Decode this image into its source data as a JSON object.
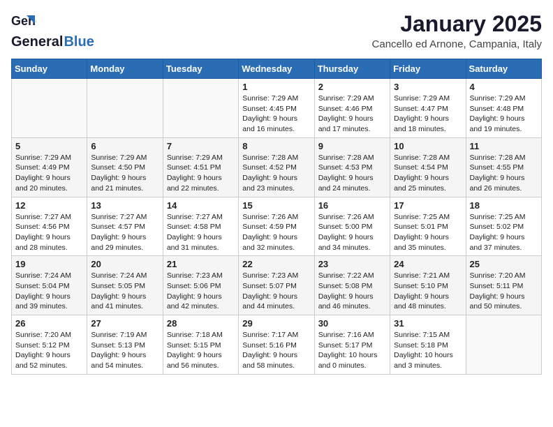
{
  "header": {
    "logo_general": "General",
    "logo_blue": "Blue",
    "month_title": "January 2025",
    "location": "Cancello ed Arnone, Campania, Italy"
  },
  "weekdays": [
    "Sunday",
    "Monday",
    "Tuesday",
    "Wednesday",
    "Thursday",
    "Friday",
    "Saturday"
  ],
  "weeks": [
    [
      {
        "day": "",
        "info": ""
      },
      {
        "day": "",
        "info": ""
      },
      {
        "day": "",
        "info": ""
      },
      {
        "day": "1",
        "info": "Sunrise: 7:29 AM\nSunset: 4:45 PM\nDaylight: 9 hours\nand 16 minutes."
      },
      {
        "day": "2",
        "info": "Sunrise: 7:29 AM\nSunset: 4:46 PM\nDaylight: 9 hours\nand 17 minutes."
      },
      {
        "day": "3",
        "info": "Sunrise: 7:29 AM\nSunset: 4:47 PM\nDaylight: 9 hours\nand 18 minutes."
      },
      {
        "day": "4",
        "info": "Sunrise: 7:29 AM\nSunset: 4:48 PM\nDaylight: 9 hours\nand 19 minutes."
      }
    ],
    [
      {
        "day": "5",
        "info": "Sunrise: 7:29 AM\nSunset: 4:49 PM\nDaylight: 9 hours\nand 20 minutes."
      },
      {
        "day": "6",
        "info": "Sunrise: 7:29 AM\nSunset: 4:50 PM\nDaylight: 9 hours\nand 21 minutes."
      },
      {
        "day": "7",
        "info": "Sunrise: 7:29 AM\nSunset: 4:51 PM\nDaylight: 9 hours\nand 22 minutes."
      },
      {
        "day": "8",
        "info": "Sunrise: 7:28 AM\nSunset: 4:52 PM\nDaylight: 9 hours\nand 23 minutes."
      },
      {
        "day": "9",
        "info": "Sunrise: 7:28 AM\nSunset: 4:53 PM\nDaylight: 9 hours\nand 24 minutes."
      },
      {
        "day": "10",
        "info": "Sunrise: 7:28 AM\nSunset: 4:54 PM\nDaylight: 9 hours\nand 25 minutes."
      },
      {
        "day": "11",
        "info": "Sunrise: 7:28 AM\nSunset: 4:55 PM\nDaylight: 9 hours\nand 26 minutes."
      }
    ],
    [
      {
        "day": "12",
        "info": "Sunrise: 7:27 AM\nSunset: 4:56 PM\nDaylight: 9 hours\nand 28 minutes."
      },
      {
        "day": "13",
        "info": "Sunrise: 7:27 AM\nSunset: 4:57 PM\nDaylight: 9 hours\nand 29 minutes."
      },
      {
        "day": "14",
        "info": "Sunrise: 7:27 AM\nSunset: 4:58 PM\nDaylight: 9 hours\nand 31 minutes."
      },
      {
        "day": "15",
        "info": "Sunrise: 7:26 AM\nSunset: 4:59 PM\nDaylight: 9 hours\nand 32 minutes."
      },
      {
        "day": "16",
        "info": "Sunrise: 7:26 AM\nSunset: 5:00 PM\nDaylight: 9 hours\nand 34 minutes."
      },
      {
        "day": "17",
        "info": "Sunrise: 7:25 AM\nSunset: 5:01 PM\nDaylight: 9 hours\nand 35 minutes."
      },
      {
        "day": "18",
        "info": "Sunrise: 7:25 AM\nSunset: 5:02 PM\nDaylight: 9 hours\nand 37 minutes."
      }
    ],
    [
      {
        "day": "19",
        "info": "Sunrise: 7:24 AM\nSunset: 5:04 PM\nDaylight: 9 hours\nand 39 minutes."
      },
      {
        "day": "20",
        "info": "Sunrise: 7:24 AM\nSunset: 5:05 PM\nDaylight: 9 hours\nand 41 minutes."
      },
      {
        "day": "21",
        "info": "Sunrise: 7:23 AM\nSunset: 5:06 PM\nDaylight: 9 hours\nand 42 minutes."
      },
      {
        "day": "22",
        "info": "Sunrise: 7:23 AM\nSunset: 5:07 PM\nDaylight: 9 hours\nand 44 minutes."
      },
      {
        "day": "23",
        "info": "Sunrise: 7:22 AM\nSunset: 5:08 PM\nDaylight: 9 hours\nand 46 minutes."
      },
      {
        "day": "24",
        "info": "Sunrise: 7:21 AM\nSunset: 5:10 PM\nDaylight: 9 hours\nand 48 minutes."
      },
      {
        "day": "25",
        "info": "Sunrise: 7:20 AM\nSunset: 5:11 PM\nDaylight: 9 hours\nand 50 minutes."
      }
    ],
    [
      {
        "day": "26",
        "info": "Sunrise: 7:20 AM\nSunset: 5:12 PM\nDaylight: 9 hours\nand 52 minutes."
      },
      {
        "day": "27",
        "info": "Sunrise: 7:19 AM\nSunset: 5:13 PM\nDaylight: 9 hours\nand 54 minutes."
      },
      {
        "day": "28",
        "info": "Sunrise: 7:18 AM\nSunset: 5:15 PM\nDaylight: 9 hours\nand 56 minutes."
      },
      {
        "day": "29",
        "info": "Sunrise: 7:17 AM\nSunset: 5:16 PM\nDaylight: 9 hours\nand 58 minutes."
      },
      {
        "day": "30",
        "info": "Sunrise: 7:16 AM\nSunset: 5:17 PM\nDaylight: 10 hours\nand 0 minutes."
      },
      {
        "day": "31",
        "info": "Sunrise: 7:15 AM\nSunset: 5:18 PM\nDaylight: 10 hours\nand 3 minutes."
      },
      {
        "day": "",
        "info": ""
      }
    ]
  ]
}
